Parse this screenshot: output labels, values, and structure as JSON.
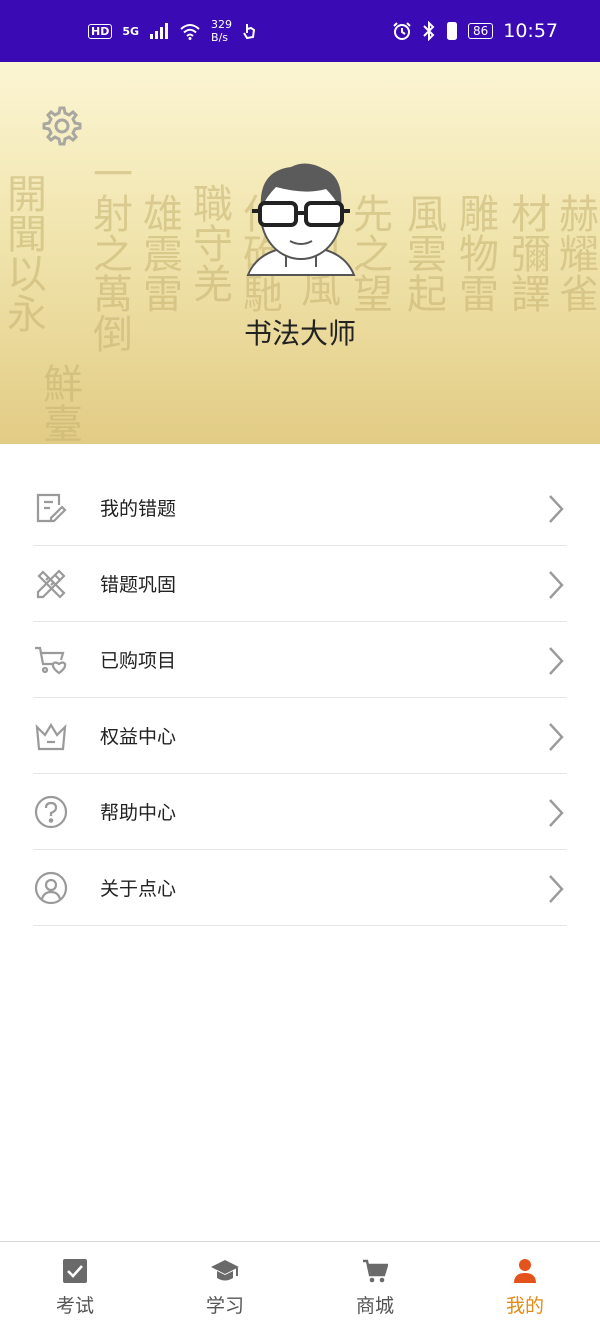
{
  "status_bar": {
    "hd": "HD",
    "network": "5G",
    "net_speed_value": "329",
    "net_speed_unit": "B/s",
    "battery": "86",
    "time": "10:57"
  },
  "profile": {
    "username": "书法大师"
  },
  "menu": {
    "items": [
      {
        "label": "我的错题",
        "icon": "note-edit-icon"
      },
      {
        "label": "错题巩固",
        "icon": "pencil-ruler-icon"
      },
      {
        "label": "已购项目",
        "icon": "cart-heart-icon"
      },
      {
        "label": "权益中心",
        "icon": "crown-icon"
      },
      {
        "label": "帮助中心",
        "icon": "question-circle-icon"
      },
      {
        "label": "关于点心",
        "icon": "user-circle-icon"
      }
    ]
  },
  "bottom_nav": {
    "items": [
      {
        "label": "考试",
        "icon": "checkbox-icon",
        "active": false
      },
      {
        "label": "学习",
        "icon": "graduation-cap-icon",
        "active": false
      },
      {
        "label": "商城",
        "icon": "cart-icon",
        "active": false
      },
      {
        "label": "我的",
        "icon": "person-icon",
        "active": true
      }
    ]
  },
  "colors": {
    "status_bar": "#3a0ab4",
    "header_top": "#fbf5d3",
    "header_bottom": "#e2cc85",
    "accent": "#e48c16",
    "icon_gray": "#9a9a9a"
  }
}
